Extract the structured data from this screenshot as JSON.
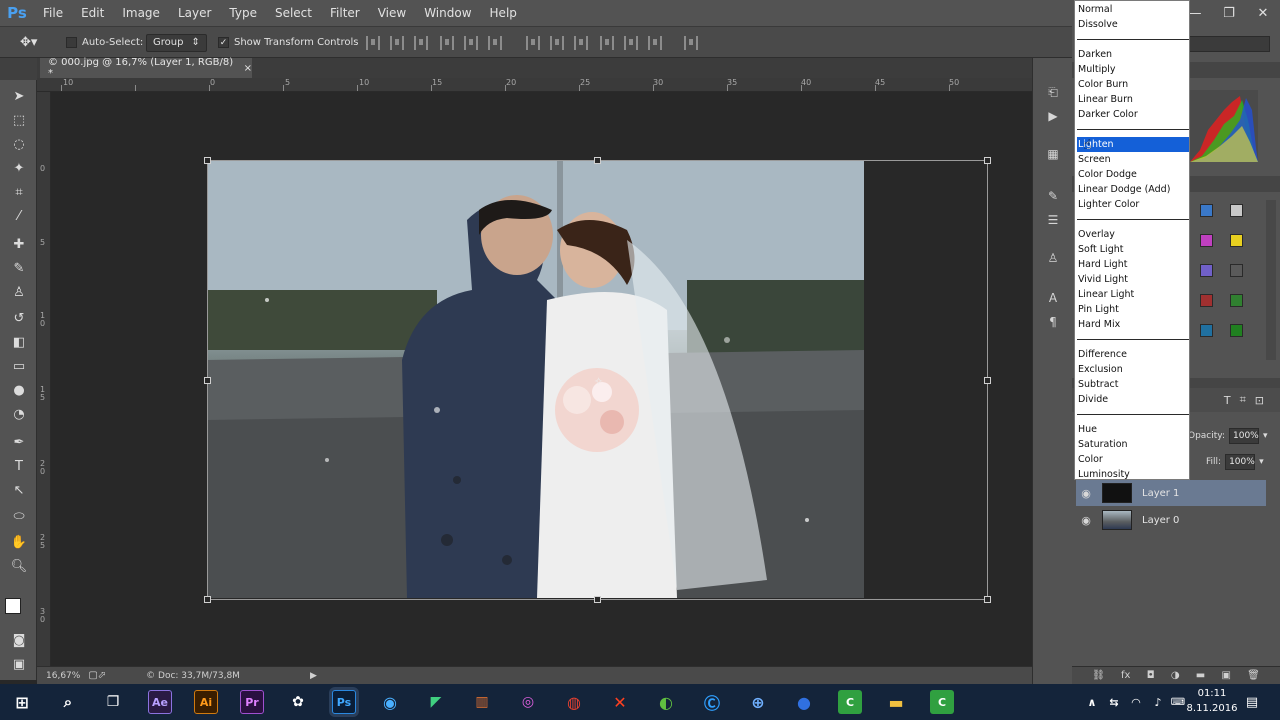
{
  "app": {
    "logo": "Ps"
  },
  "menu": [
    "File",
    "Edit",
    "Image",
    "Layer",
    "Type",
    "Select",
    "Filter",
    "View",
    "Window",
    "Help"
  ],
  "window_controls": {
    "minimize": "—",
    "restore": "❐",
    "close": "✕"
  },
  "options": {
    "auto_select_label": "Auto-Select:",
    "auto_select_value": "Group",
    "show_transform_label": "Show Transform Controls",
    "show_transform_checked": true
  },
  "document": {
    "tab_title": "© 000.jpg @ 16,7% (Layer 1, RGB/8) *",
    "tab_close": "×"
  },
  "ruler_h_ticks": [
    "10",
    "0",
    "5",
    "10",
    "15",
    "20",
    "25",
    "30",
    "35",
    "40",
    "45",
    "50"
  ],
  "ruler_v_ticks": [
    "0",
    "5",
    "1 0",
    "1 5",
    "2 0",
    "2 5",
    "3 0"
  ],
  "status": {
    "zoom": "16,67%",
    "doc": "© Doc: 33,7M/73,8M"
  },
  "blend_modes": {
    "groups": [
      [
        "Normal",
        "Dissolve"
      ],
      [
        "Darken",
        "Multiply",
        "Color Burn",
        "Linear Burn",
        "Darker Color"
      ],
      [
        "Lighten",
        "Screen",
        "Color Dodge",
        "Linear Dodge (Add)",
        "Lighter Color"
      ],
      [
        "Overlay",
        "Soft Light",
        "Hard Light",
        "Vivid Light",
        "Linear Light",
        "Pin Light",
        "Hard Mix"
      ],
      [
        "Difference",
        "Exclusion",
        "Subtract",
        "Divide"
      ],
      [
        "Hue",
        "Saturation",
        "Color",
        "Luminosity"
      ]
    ],
    "selected": "Lighten"
  },
  "layers_panel": {
    "opacity_label": "Opacity:",
    "opacity_value": "100%",
    "fill_label": "Fill:",
    "fill_value": "100%",
    "layers": [
      {
        "name": "Layer 1",
        "selected": true
      },
      {
        "name": "Layer 0",
        "selected": false
      }
    ]
  },
  "taskbar": {
    "apps": [
      "Ae",
      "Ai",
      "Pr",
      "Ps"
    ],
    "time": "01:11",
    "date": "8.11.2016"
  },
  "colors": {
    "accent": "#1460d8",
    "menubar": "#535353",
    "canvas_bg": "#282828",
    "selected_layer": "#6a7a92"
  }
}
